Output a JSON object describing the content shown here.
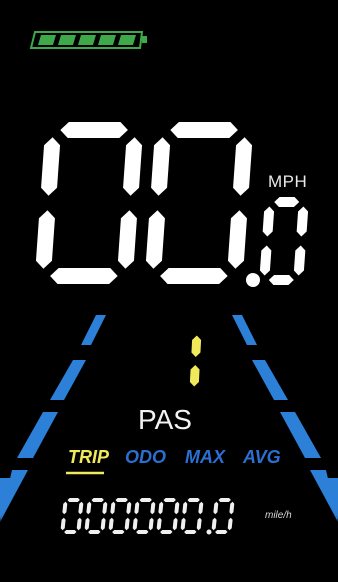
{
  "battery": {
    "bars": 5,
    "level": 1.0,
    "color": "#3fa84a"
  },
  "speed": {
    "whole": "00",
    "decimal": "0",
    "unit": "MPH",
    "digit_color": "#ffffff"
  },
  "pas": {
    "level": "1",
    "label": "PAS",
    "level_color": "#f0ea5a"
  },
  "modes": {
    "tabs": [
      {
        "label": "TRIP",
        "active": true
      },
      {
        "label": "ODO",
        "active": false
      },
      {
        "label": "MAX",
        "active": false
      },
      {
        "label": "AVG",
        "active": false
      }
    ],
    "active_color": "#f0ea5a",
    "inactive_color": "#2c6fd2"
  },
  "odometer": {
    "value": "000000",
    "decimal": "0",
    "unit": "mile/h"
  },
  "road": {
    "lane_color": "#2d80d8"
  }
}
